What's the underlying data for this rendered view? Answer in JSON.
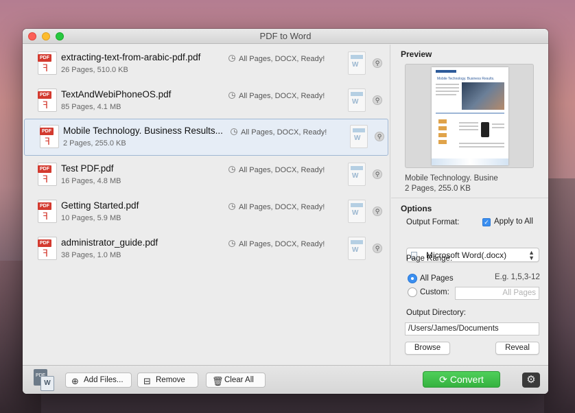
{
  "window": {
    "title": "PDF to Word"
  },
  "files": [
    {
      "name": "extracting-text-from-arabic-pdf.pdf",
      "meta": "26 Pages, 510.0 KB",
      "status": "All Pages, DOCX, Ready!"
    },
    {
      "name": "TextAndWebiPhoneOS.pdf",
      "meta": "85 Pages, 4.1 MB",
      "status": "All Pages, DOCX, Ready!"
    },
    {
      "name": "Mobile Technology. Business Results...",
      "meta": "2 Pages, 255.0 KB",
      "status": "All Pages, DOCX, Ready!",
      "selected": true
    },
    {
      "name": "Test PDF.pdf",
      "meta": "16 Pages, 4.8 MB",
      "status": "All Pages, DOCX, Ready!"
    },
    {
      "name": "Getting Started.pdf",
      "meta": "10 Pages, 5.9 MB",
      "status": "All Pages, DOCX, Ready!"
    },
    {
      "name": "administrator_guide.pdf",
      "meta": "38 Pages, 1.0 MB",
      "status": "All Pages, DOCX, Ready!"
    }
  ],
  "icons": {
    "pdf_tag": "PDF",
    "doc_letter": "W",
    "app_pdf": "PDF",
    "app_w": "W"
  },
  "preview": {
    "heading": "Preview",
    "page_title": "Mobile Technology. Business Results.",
    "name": "Mobile Technology. Busine",
    "meta": "2 Pages, 255.0 KB"
  },
  "options": {
    "heading": "Options",
    "output_format_label": "Output Format:",
    "apply_to_all_label": "Apply to All",
    "apply_to_all": true,
    "format_value": "Microsoft Word(.docx)",
    "page_range_label": "Page Range:",
    "all_pages_label": "All Pages",
    "example_hint": "E.g. 1,5,3-12",
    "custom_label": "Custom:",
    "custom_placeholder": "All Pages",
    "output_dir_label": "Output Directory:",
    "output_dir_value": "/Users/James/Documents",
    "browse_label": "Browse",
    "reveal_label": "Reveal"
  },
  "toolbar": {
    "add_files_label": "Add Files...",
    "remove_label": "Remove",
    "clear_all_label": "Clear All",
    "convert_label": "Convert"
  },
  "colors": {
    "accent": "#3b8ff0",
    "convert": "#35b23f",
    "pdf_red": "#d33a2f",
    "selection": "#e6edf6"
  }
}
